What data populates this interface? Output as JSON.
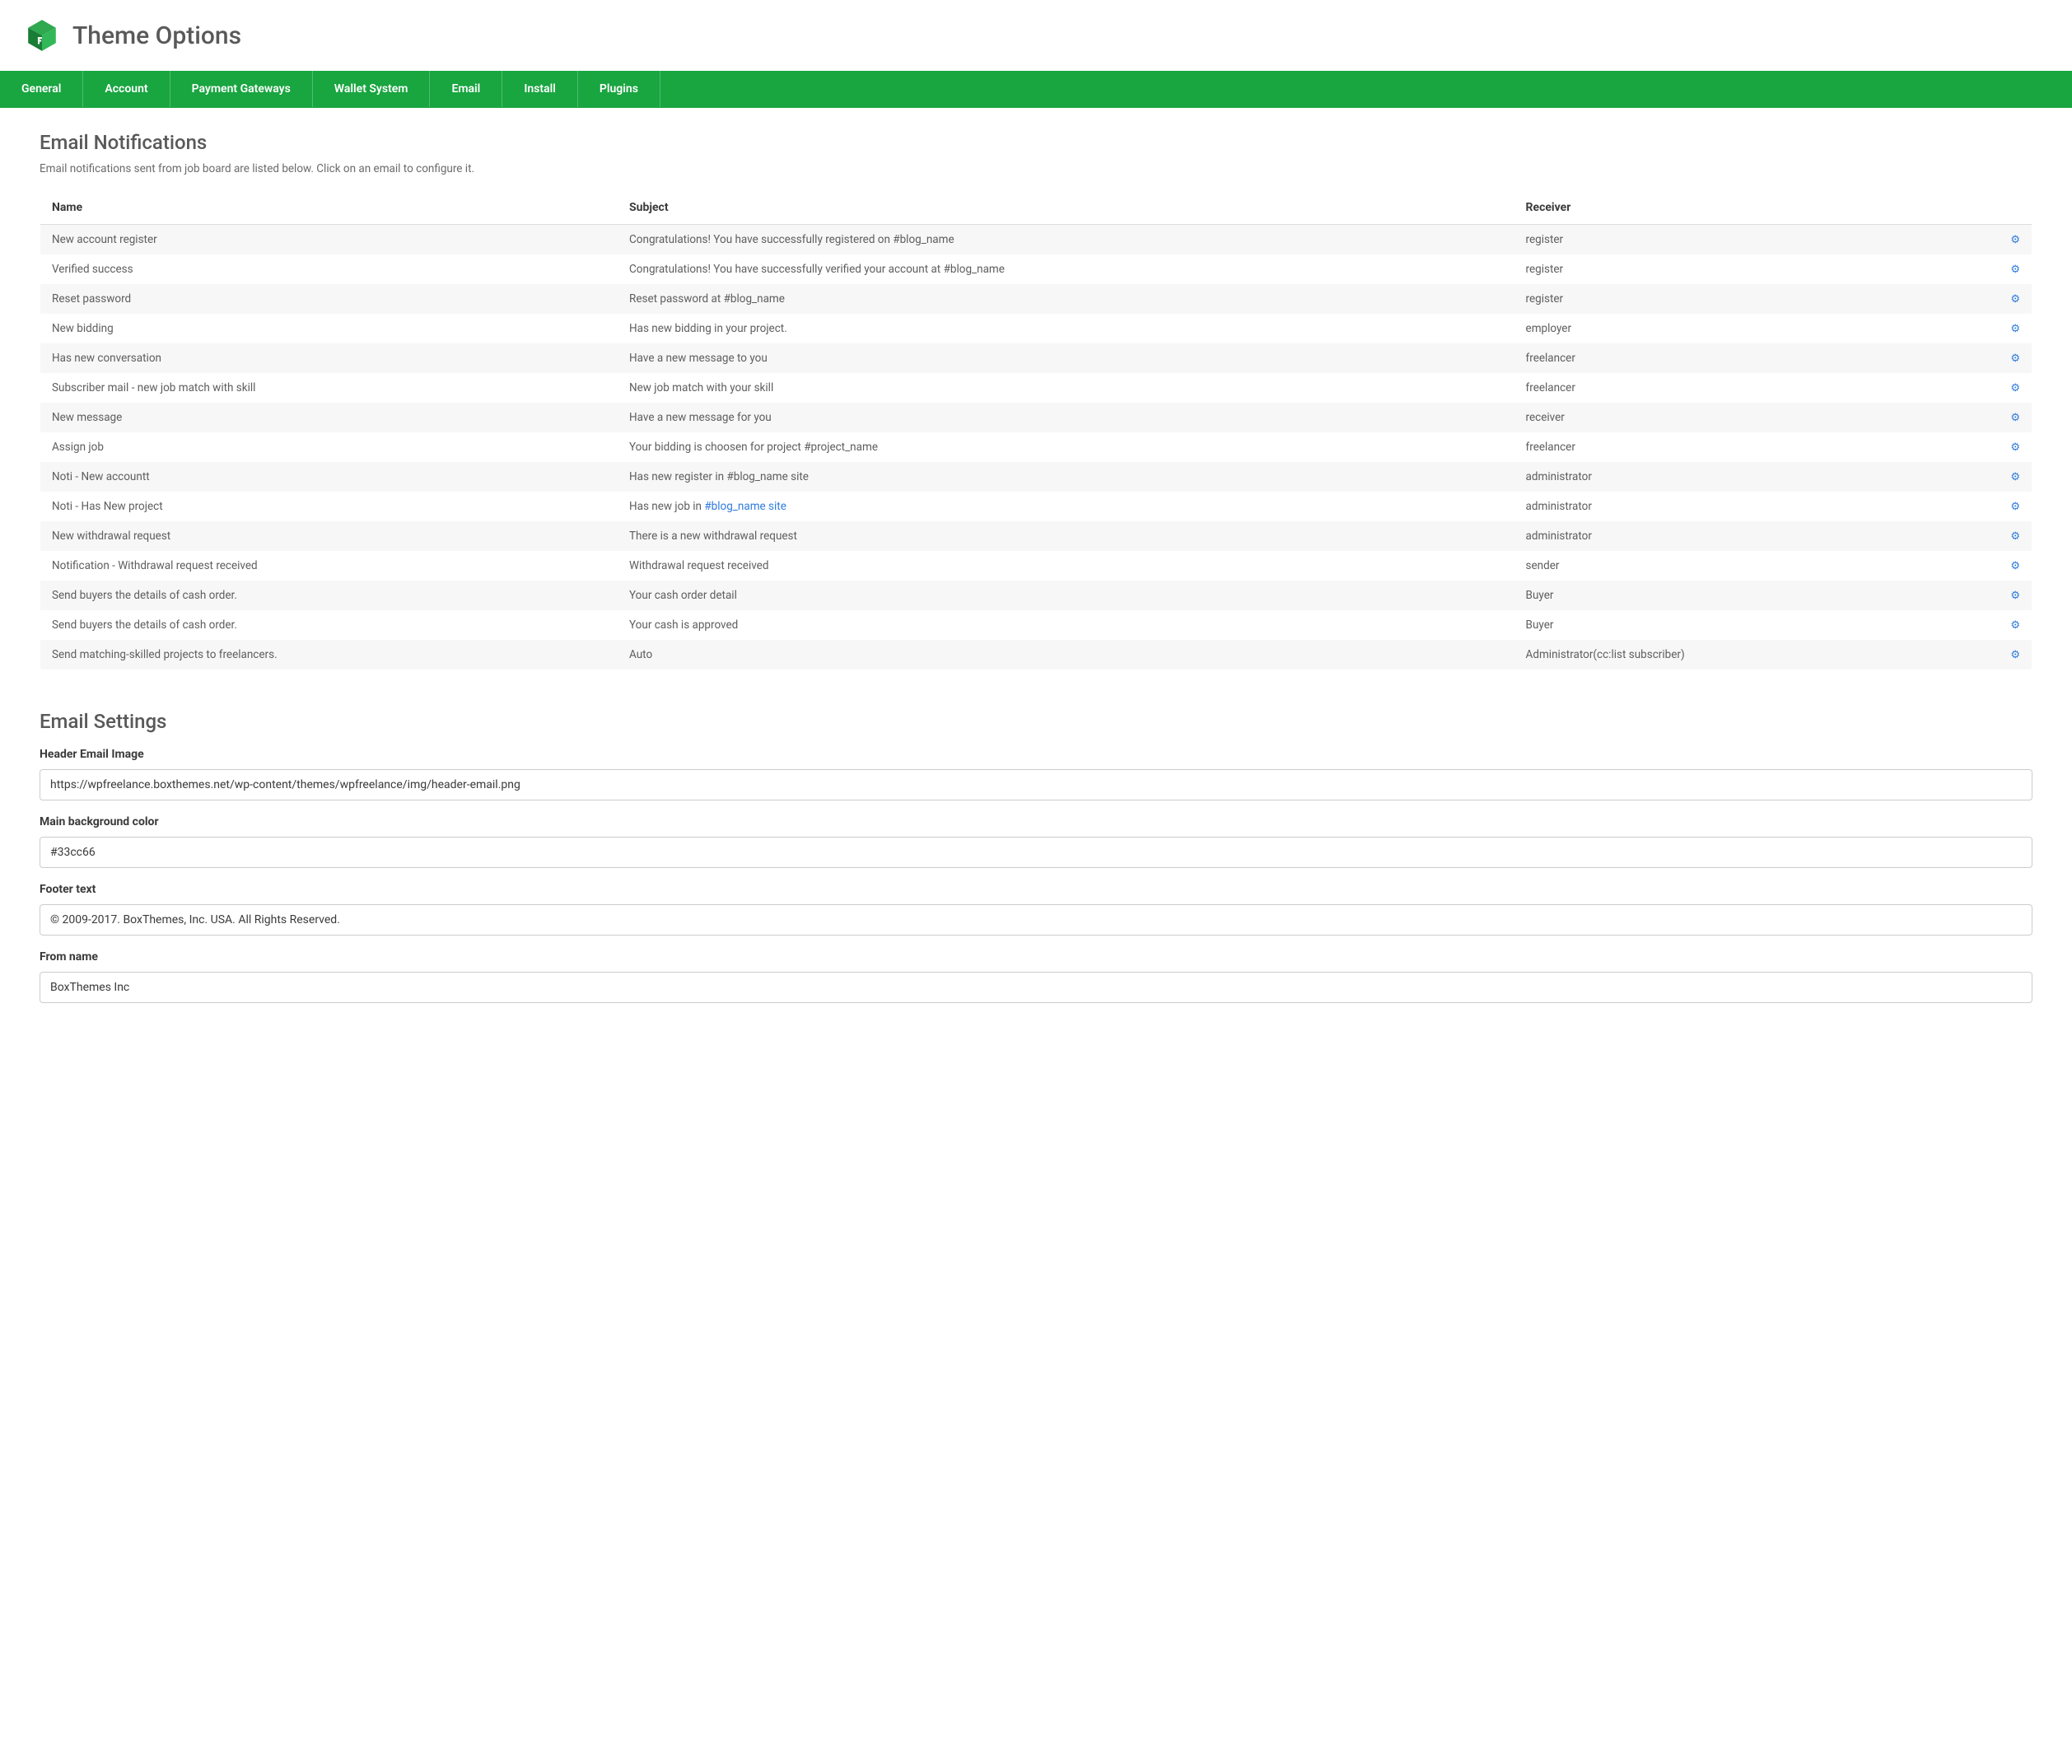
{
  "header": {
    "title": "Theme Options"
  },
  "tabs": [
    "General",
    "Account",
    "Payment Gateways",
    "Wallet System",
    "Email",
    "Install",
    "Plugins"
  ],
  "notifications": {
    "title": "Email Notifications",
    "description": "Email notifications sent from job board are listed below. Click on an email to configure it.",
    "columns": {
      "name": "Name",
      "subject": "Subject",
      "receiver": "Receiver"
    },
    "rows": [
      {
        "name": "New account register",
        "subject": "Congratulations! You have successfully registered on #blog_name",
        "receiver": "register"
      },
      {
        "name": "Verified success",
        "subject": "Congratulations! You have successfully verified your account at #blog_name",
        "receiver": "register"
      },
      {
        "name": "Reset password",
        "subject": "Reset password at #blog_name",
        "receiver": "register"
      },
      {
        "name": "New bidding",
        "subject": "Has new bidding in your project.",
        "receiver": "employer"
      },
      {
        "name": "Has new conversation",
        "subject": "Have a new message to you",
        "receiver": "freelancer"
      },
      {
        "name": "Subscriber mail - new job match with skill",
        "subject": "New job match with your skill",
        "receiver": "freelancer"
      },
      {
        "name": "New message",
        "subject": "Have a new message for you",
        "receiver": "receiver"
      },
      {
        "name": "Assign job",
        "subject": "Your bidding is choosen for project #project_name",
        "receiver": "freelancer"
      },
      {
        "name": "Noti - New accountt",
        "subject": "Has new register in #blog_name site",
        "receiver": "administrator"
      },
      {
        "name": "Noti - Has New project",
        "subject_prefix": "Has new job in ",
        "subject_link": "#blog_name site",
        "receiver": "administrator"
      },
      {
        "name": "New withdrawal request",
        "subject": "There is a new withdrawal request",
        "receiver": "administrator"
      },
      {
        "name": "Notification - Withdrawal request received",
        "subject": "Withdrawal request received",
        "receiver": "sender"
      },
      {
        "name": "Send buyers the details of cash order.",
        "subject": "Your cash order detail",
        "receiver": "Buyer"
      },
      {
        "name": "Send buyers the details of cash order.",
        "subject": "Your cash is approved",
        "receiver": "Buyer"
      },
      {
        "name": "Send matching-skilled projects to freelancers.",
        "subject": "Auto",
        "receiver": "Administrator(cc:list subscriber)"
      }
    ]
  },
  "settings": {
    "title": "Email Settings",
    "fields": {
      "header_image": {
        "label": "Header Email Image",
        "value": "https://wpfreelance.boxthemes.net/wp-content/themes/wpfreelance/img/header-email.png"
      },
      "bg_color": {
        "label": "Main background color",
        "value": "#33cc66"
      },
      "footer_text": {
        "label": "Footer text",
        "value": "© 2009-2017. BoxThemes, Inc. USA. All Rights Reserved."
      },
      "from_name": {
        "label": "From name",
        "value": "BoxThemes Inc"
      }
    }
  }
}
